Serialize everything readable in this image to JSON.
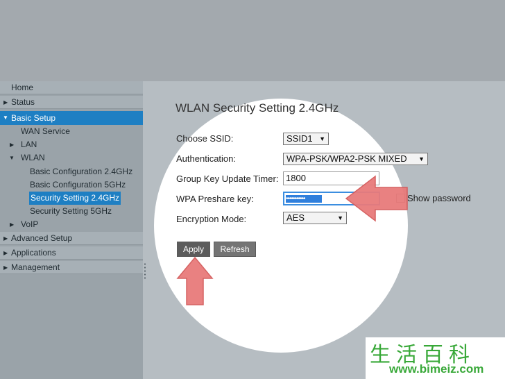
{
  "sidebar": {
    "items": [
      {
        "label": "Home",
        "arrow": ""
      },
      {
        "label": "Status",
        "arrow": "▶"
      },
      {
        "label": "Basic Setup",
        "arrow": "▼"
      },
      {
        "label": "WAN Service",
        "arrow": ""
      },
      {
        "label": "LAN",
        "arrow": "▶"
      },
      {
        "label": "WLAN",
        "arrow": "▼"
      },
      {
        "label": "Basic Configuration 2.4GHz",
        "arrow": ""
      },
      {
        "label": "Basic Configuration 5GHz",
        "arrow": ""
      },
      {
        "label": "Security Setting 2.4GHz",
        "arrow": ""
      },
      {
        "label": "Security Setting 5GHz",
        "arrow": ""
      },
      {
        "label": "VoIP",
        "arrow": "▶"
      },
      {
        "label": "Advanced Setup",
        "arrow": "▶"
      },
      {
        "label": "Applications",
        "arrow": "▶"
      },
      {
        "label": "Management",
        "arrow": "▶"
      }
    ]
  },
  "main": {
    "title": "WLAN Security Setting 2.4GHz",
    "fields": {
      "ssid": {
        "label": "Choose SSID:",
        "value": "SSID1"
      },
      "auth": {
        "label": "Authentication:",
        "value": "WPA-PSK/WPA2-PSK MIXED"
      },
      "group_key": {
        "label": "Group Key Update Timer:",
        "value": "1800"
      },
      "wpa_key": {
        "label": "WPA Preshare key:",
        "value": "•••••••••••"
      },
      "encryption": {
        "label": "Encryption Mode:",
        "value": "AES"
      }
    },
    "show_password_label": "Show password",
    "caret": "▼",
    "apply_label": "Apply",
    "refresh_label": "Refresh"
  },
  "watermark": {
    "chars": "生活百科",
    "url": "www.bimeiz.com"
  },
  "colors": {
    "accent": "#1e7fc3",
    "arrow_fill": "#e87b7b"
  }
}
